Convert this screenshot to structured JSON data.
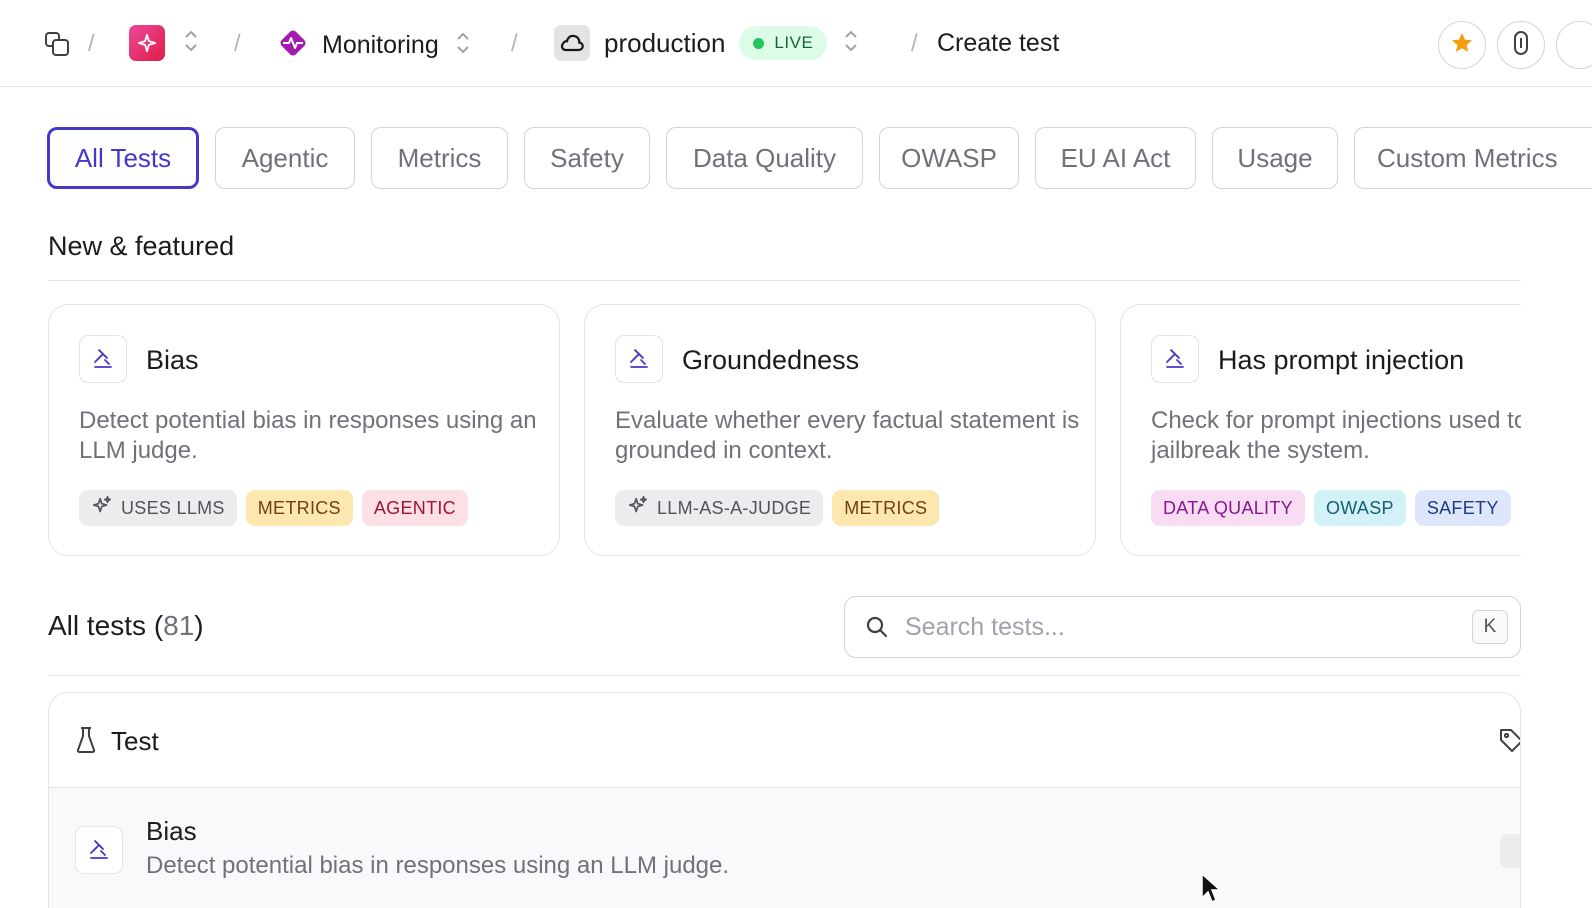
{
  "breadcrumb": {
    "project": "Monitoring",
    "environment": "production",
    "environment_status": "LIVE",
    "page": "Create test"
  },
  "filter_tabs": [
    "All Tests",
    "Agentic",
    "Metrics",
    "Safety",
    "Data Quality",
    "OWASP",
    "EU AI Act",
    "Usage",
    "Custom Metrics"
  ],
  "active_tab": "All Tests",
  "featured": {
    "title": "New & featured",
    "cards": [
      {
        "title": "Bias",
        "description": "Detect potential bias in responses using an LLM judge.",
        "tags": [
          "USES LLMS",
          "METRICS",
          "AGENTIC"
        ]
      },
      {
        "title": "Groundedness",
        "description": "Evaluate whether every factual statement is grounded in context.",
        "tags": [
          "LLM-AS-A-JUDGE",
          "METRICS"
        ]
      },
      {
        "title": "Has prompt injection",
        "description": "Check for prompt injections used to jailbreak the system.",
        "tags": [
          "DATA QUALITY",
          "OWASP",
          "SAFETY"
        ]
      }
    ]
  },
  "all_tests": {
    "title": "All tests",
    "count_open": "(",
    "count": "81",
    "count_close": ")",
    "search_placeholder": "Search tests...",
    "search_shortcut": "K",
    "table_header": "Test",
    "rows": [
      {
        "title": "Bias",
        "description": "Detect potential bias in responses using an LLM judge."
      }
    ]
  },
  "colors": {
    "accent": "#4338ca",
    "live_green": "#22c55e",
    "app_pink": "#ec4899",
    "project_purple": "#a21caf",
    "star_orange": "#f59e0b"
  },
  "icons": {
    "projects": "projects-stack-icon",
    "app": "sparkle-icon",
    "project": "pulse-diamond-icon",
    "environment": "cloud-icon",
    "favorite": "star-icon",
    "link": "link-icon",
    "test_card": "gavel-icon",
    "search": "search-icon",
    "test_col": "flask-icon",
    "tags_col": "tag-icon"
  }
}
